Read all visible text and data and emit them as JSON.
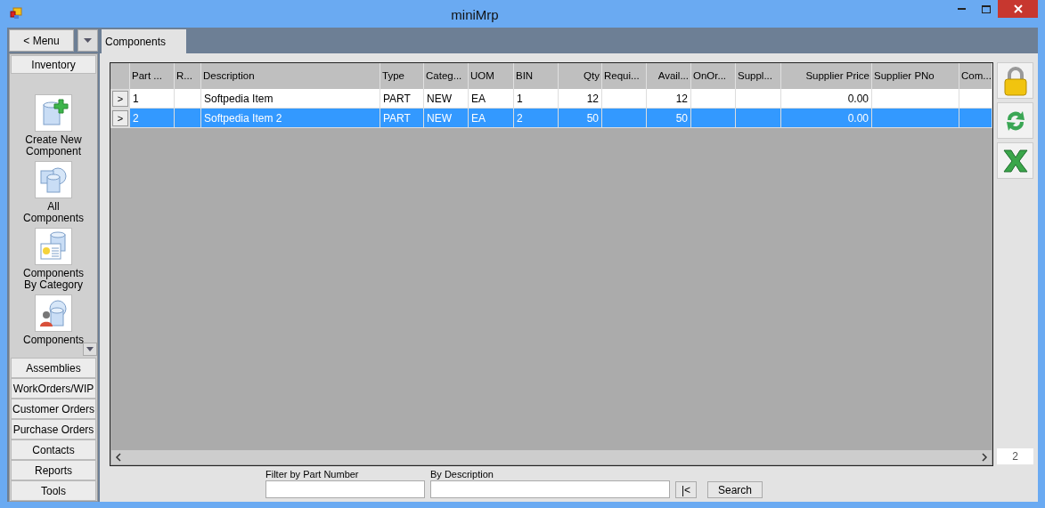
{
  "window": {
    "title": "miniMrp"
  },
  "menu_button": "< Menu",
  "sidebar": {
    "section": "Inventory",
    "items": [
      {
        "label": "Create New Component",
        "kind": "create"
      },
      {
        "label": "All Components",
        "kind": "all"
      },
      {
        "label": "Components By Category",
        "kind": "category"
      },
      {
        "label": "Components",
        "kind": "person"
      }
    ],
    "modules": [
      "Assemblies",
      "WorkOrders/WIP",
      "Customer Orders",
      "Purchase Orders",
      "Contacts",
      "Reports",
      "Tools"
    ]
  },
  "tabs": [
    {
      "label": "Components",
      "selected": true
    }
  ],
  "table": {
    "columns": [
      {
        "label": "Part ...",
        "right_aligned": false
      },
      {
        "label": "R...",
        "right_aligned": false
      },
      {
        "label": "Description",
        "right_aligned": false
      },
      {
        "label": "Type",
        "right_aligned": false
      },
      {
        "label": "Categ...",
        "right_aligned": false
      },
      {
        "label": "UOM",
        "right_aligned": false
      },
      {
        "label": "BIN",
        "right_aligned": false
      },
      {
        "label": "Qty",
        "right_aligned": true
      },
      {
        "label": "Requi...",
        "right_aligned": false
      },
      {
        "label": "Avail...",
        "right_aligned": true
      },
      {
        "label": "OnOr...",
        "right_aligned": false
      },
      {
        "label": "Suppl...",
        "right_aligned": false
      },
      {
        "label": "Supplier Price",
        "right_aligned": true
      },
      {
        "label": "Supplier PNo",
        "right_aligned": false
      },
      {
        "label": "Com...",
        "right_aligned": false
      }
    ],
    "rows": [
      {
        "marker": ">",
        "selected": false,
        "cells": [
          "1",
          "",
          "Softpedia Item",
          "PART",
          "NEW",
          "EA",
          "1",
          "12",
          "",
          "12",
          "",
          "",
          "0.00",
          "",
          ""
        ]
      },
      {
        "marker": ">",
        "selected": true,
        "cells": [
          "2",
          "",
          "Softpedia Item 2",
          "PART",
          "NEW",
          "EA",
          "2",
          "50",
          "",
          "50",
          "",
          "",
          "0.00",
          "",
          ""
        ]
      }
    ]
  },
  "record_count": "2",
  "filters": {
    "part_label": "Filter by Part Number",
    "description_label": "By Description",
    "reset_button": "|<",
    "search_button": "Search"
  }
}
